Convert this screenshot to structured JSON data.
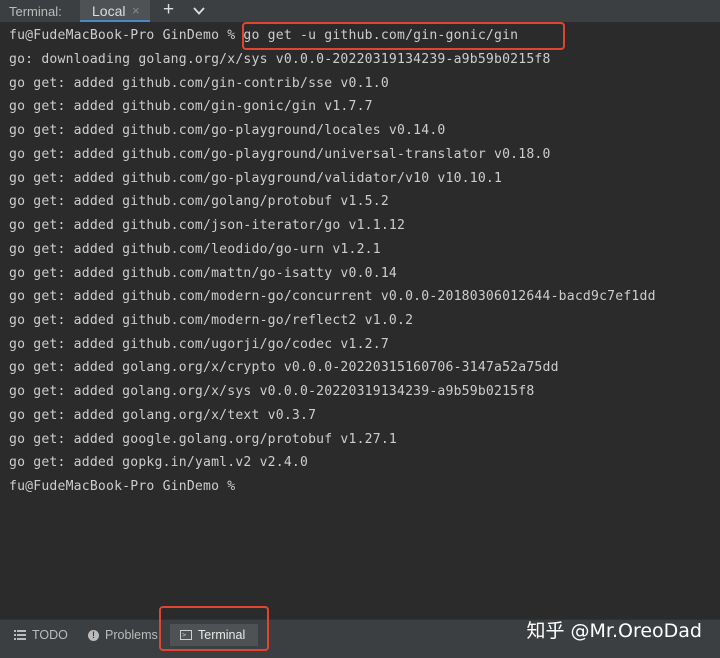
{
  "topbar": {
    "label": "Terminal:",
    "tab_local": "Local",
    "tab_close": "×",
    "new_tab": "+"
  },
  "terminal": {
    "lines": [
      "fu@FudeMacBook-Pro GinDemo % go get -u github.com/gin-gonic/gin",
      "go: downloading golang.org/x/sys v0.0.0-20220319134239-a9b59b0215f8",
      "go get: added github.com/gin-contrib/sse v0.1.0",
      "go get: added github.com/gin-gonic/gin v1.7.7",
      "go get: added github.com/go-playground/locales v0.14.0",
      "go get: added github.com/go-playground/universal-translator v0.18.0",
      "go get: added github.com/go-playground/validator/v10 v10.10.1",
      "go get: added github.com/golang/protobuf v1.5.2",
      "go get: added github.com/json-iterator/go v1.1.12",
      "go get: added github.com/leodido/go-urn v1.2.1",
      "go get: added github.com/mattn/go-isatty v0.0.14",
      "go get: added github.com/modern-go/concurrent v0.0.0-20180306012644-bacd9c7ef1dd",
      "go get: added github.com/modern-go/reflect2 v1.0.2",
      "go get: added github.com/ugorji/go/codec v1.2.7",
      "go get: added golang.org/x/crypto v0.0.0-20220315160706-3147a52a75dd",
      "go get: added golang.org/x/sys v0.0.0-20220319134239-a9b59b0215f8",
      "go get: added golang.org/x/text v0.3.7",
      "go get: added google.golang.org/protobuf v1.27.1",
      "go get: added gopkg.in/yaml.v2 v2.4.0",
      "fu@FudeMacBook-Pro GinDemo %"
    ]
  },
  "bottombar": {
    "todo": "TODO",
    "problems": "Problems",
    "terminal": "Terminal"
  },
  "watermark": "知乎 @Mr.OreoDad",
  "colors": {
    "background": "#2b2b2b",
    "text": "#cdcdcd",
    "highlight": "#e0452f"
  }
}
